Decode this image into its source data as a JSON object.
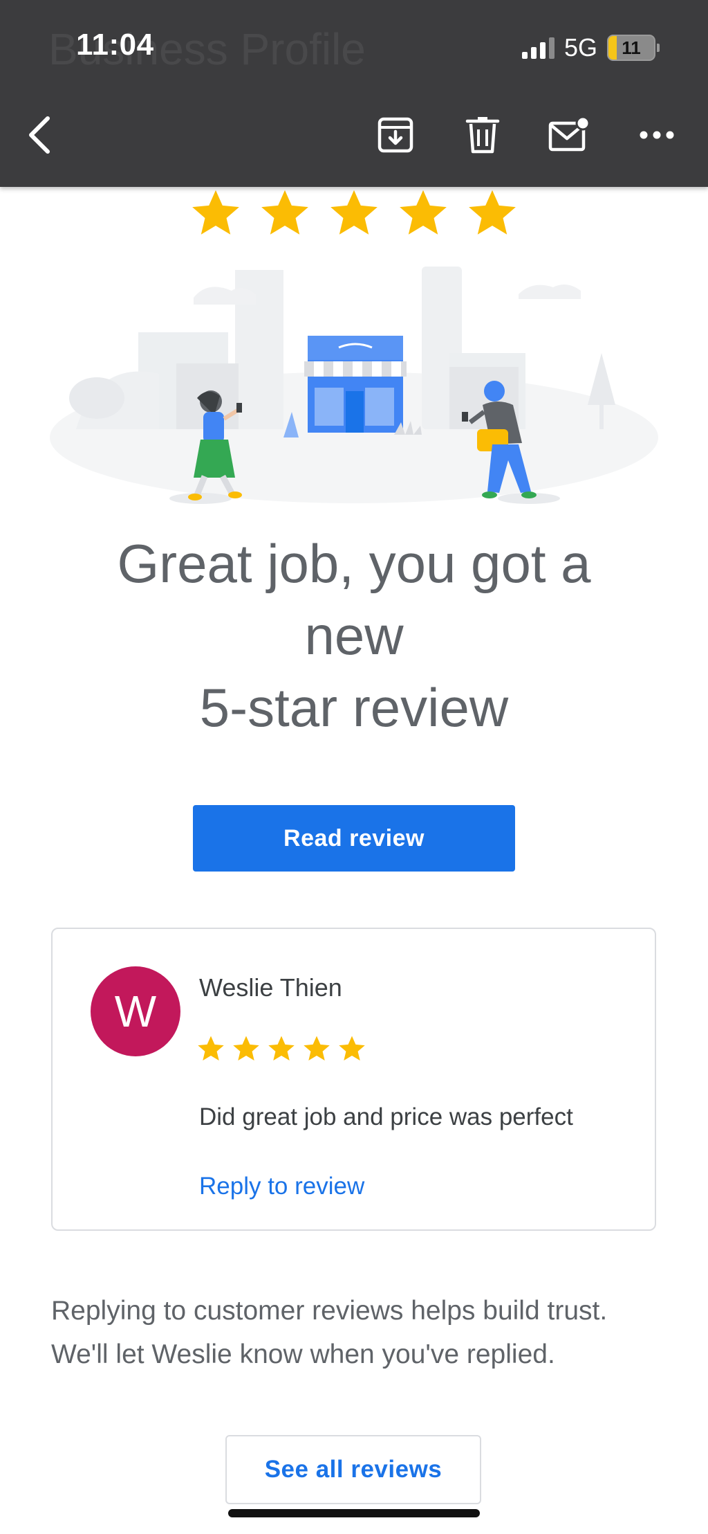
{
  "status_bar": {
    "time": "11:04",
    "network": "5G",
    "battery": "11"
  },
  "header": {
    "title_partial": "Business Profile"
  },
  "toolbar": {
    "icons": [
      "back-icon",
      "archive-icon",
      "delete-icon",
      "mark-unread-icon",
      "more-icon"
    ]
  },
  "email": {
    "star_rating": 5,
    "headline_lines": [
      "Great job, you got a",
      "new",
      "5-star review"
    ],
    "read_button_label": "Read review",
    "review": {
      "avatar_letter": "W",
      "avatar_color": "#c2185b",
      "reviewer_name": "Weslie Thien",
      "stars": 5,
      "text": "Did great job and price was perfect",
      "reply_label": "Reply to review"
    },
    "body_lines": [
      "Replying to customer reviews helps build trust.",
      "We'll let Weslie know when you've replied."
    ],
    "see_all_label": "See all reviews"
  },
  "colors": {
    "toolbar_bg": "#3c3c3e",
    "accent_blue": "#1a73e8",
    "star_yellow": "#fbbc04",
    "text_gray": "#5f6368"
  }
}
